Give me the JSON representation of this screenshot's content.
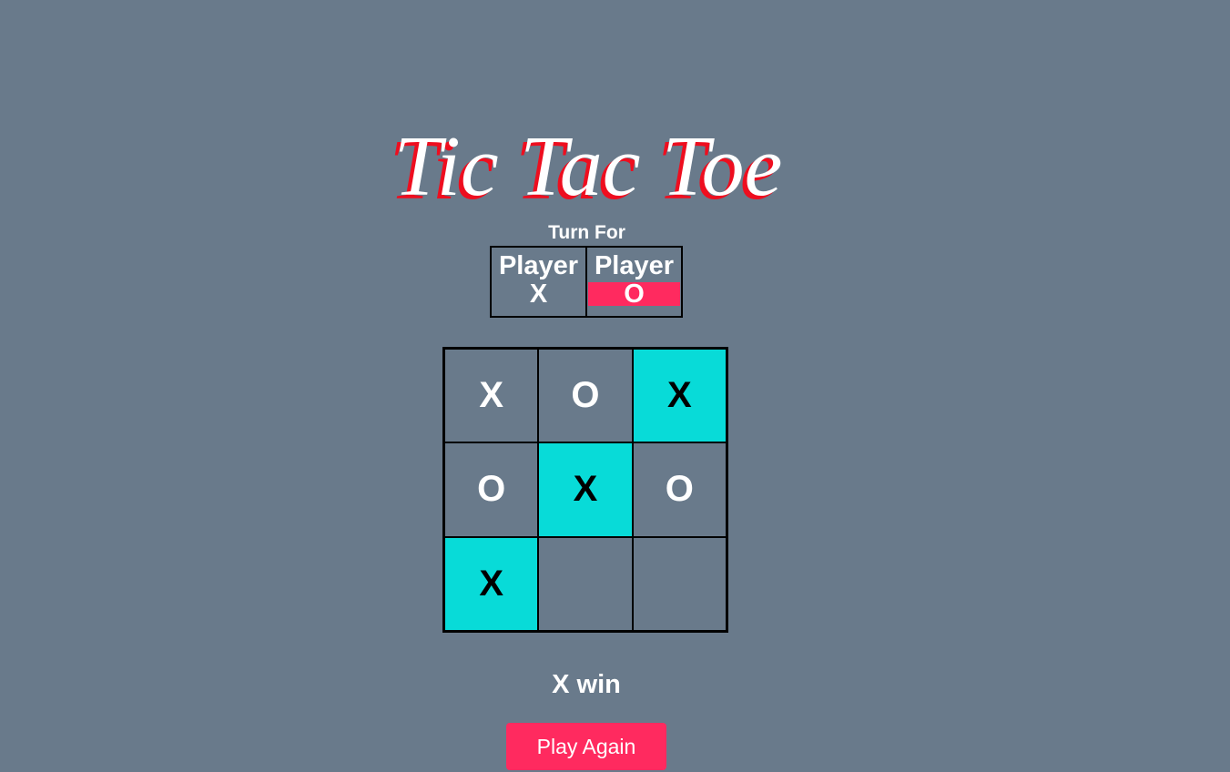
{
  "title": "Tic Tac Toe",
  "turn": {
    "label": "Turn For",
    "players": [
      {
        "name": "Player",
        "mark": "X",
        "active": false
      },
      {
        "name": "Player",
        "mark": "O",
        "active": true
      }
    ]
  },
  "board": {
    "cells": [
      "X",
      "O",
      "X",
      "O",
      "X",
      "O",
      "X",
      "",
      ""
    ],
    "winning_cells": [
      2,
      4,
      6
    ]
  },
  "result": "X win",
  "play_again_label": "Play Again",
  "colors": {
    "background": "#697a8b",
    "accent": "#ff2a5f",
    "highlight": "#08dbd8",
    "title_shadow": "#ee0e1f"
  }
}
